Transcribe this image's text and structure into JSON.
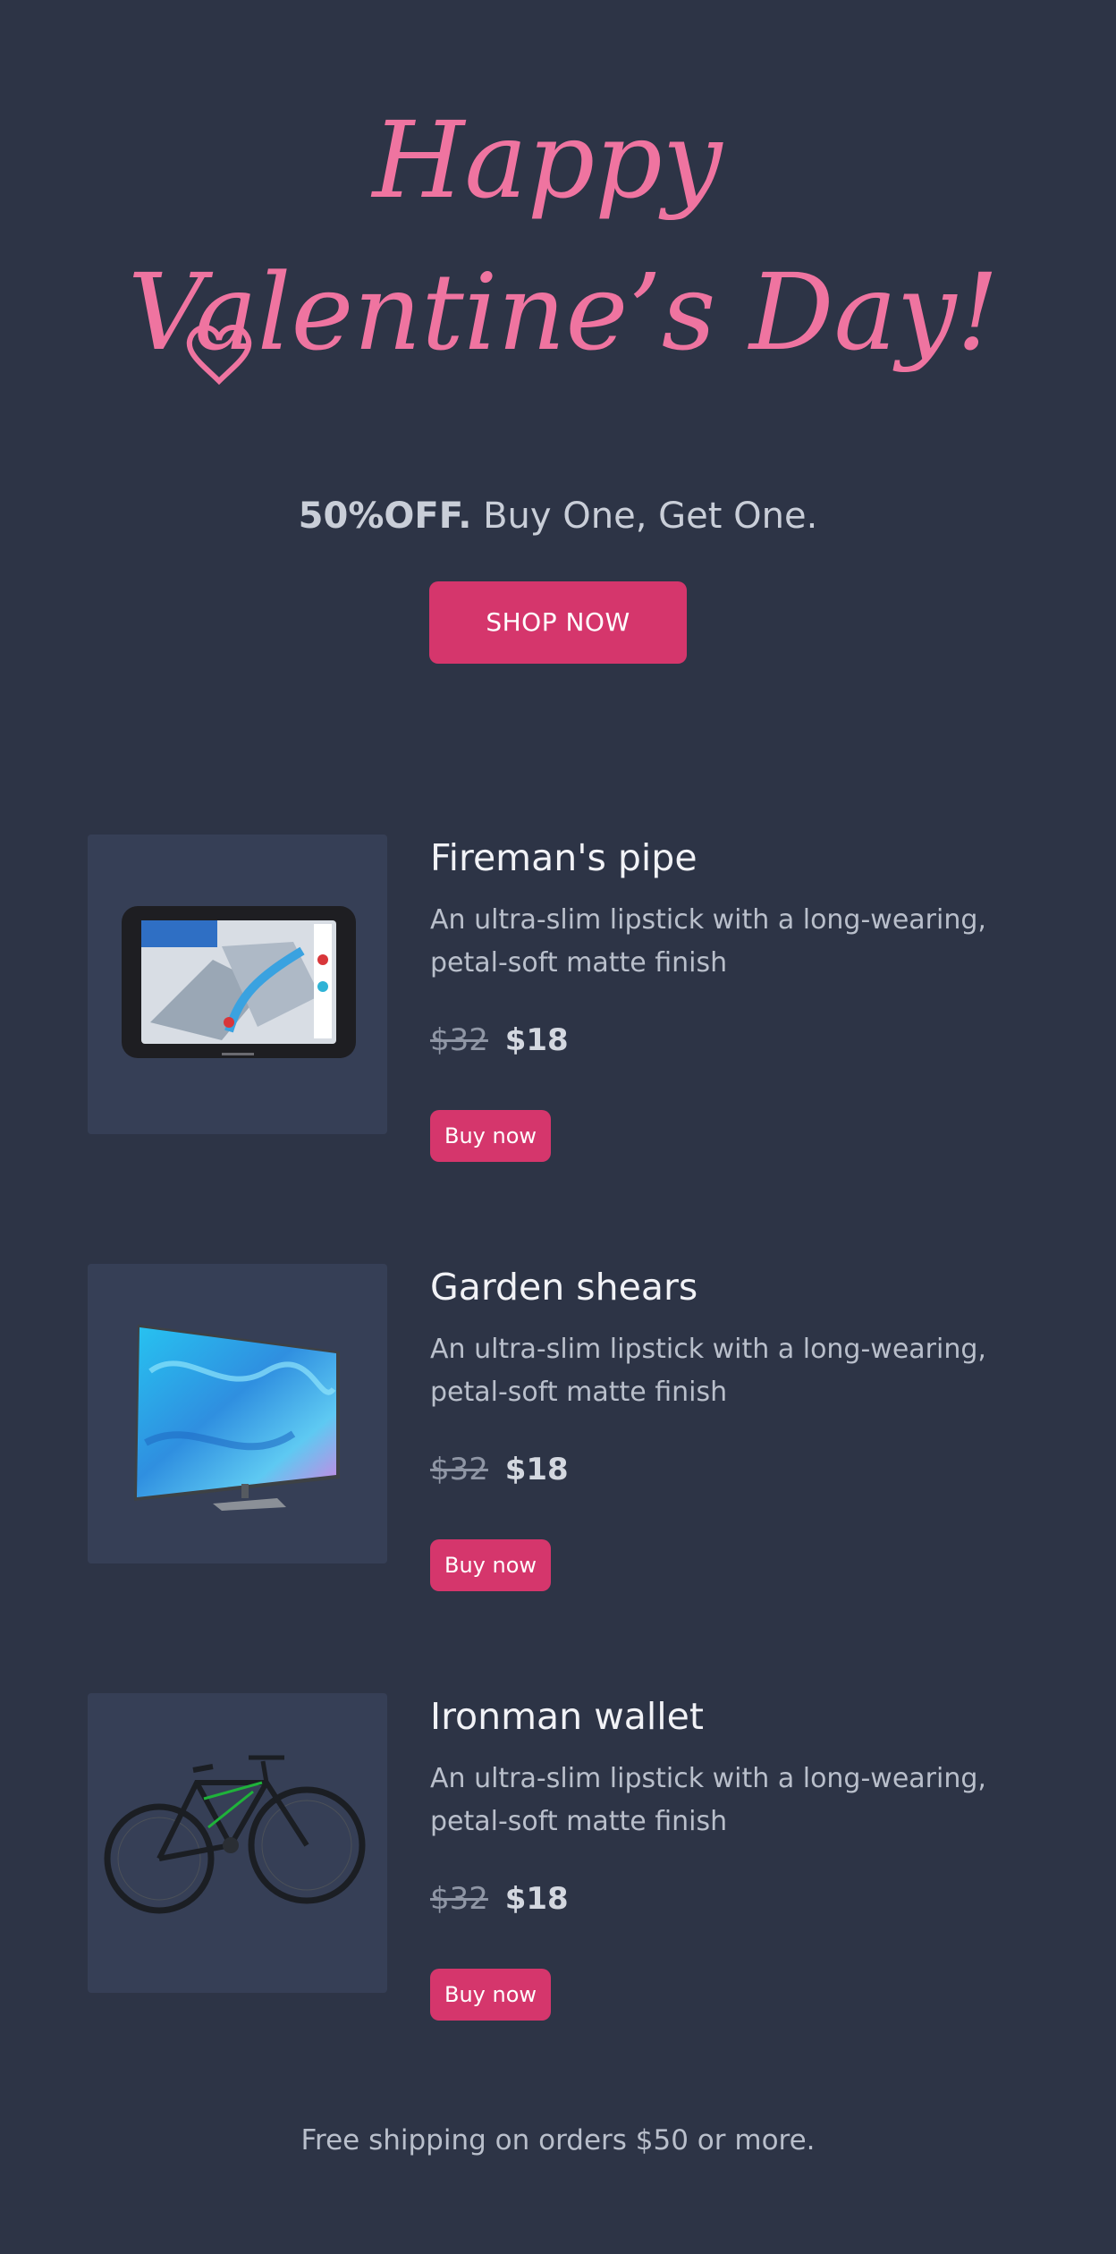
{
  "hero": {
    "title_line_1": "Happy",
    "title_line_2": "Valentine’s Day!",
    "accent_color": "#ef74a0"
  },
  "offer": {
    "strong": "50%OFF.",
    "text": "Buy One, Get One."
  },
  "cta": {
    "shop_now": "SHOP NOW",
    "button_color": "#d5366c"
  },
  "products": [
    {
      "name": "Fireman's pipe",
      "description": "An ultra-slim lipstick with a long-wearing, petal-soft matte finish",
      "old_price": "$32",
      "price": "$18",
      "button": "Buy now",
      "image": "gps-navigator"
    },
    {
      "name": "Garden shears",
      "description": "An ultra-slim lipstick with a long-wearing, petal-soft matte finish",
      "old_price": "$32",
      "price": "$18",
      "button": "Buy now",
      "image": "television"
    },
    {
      "name": "Ironman wallet",
      "description": "An ultra-slim lipstick with a long-wearing, petal-soft matte finish",
      "old_price": "$32",
      "price": "$18",
      "button": "Buy now",
      "image": "mountain-bike"
    }
  ],
  "footer": {
    "text": "Free shipping on orders $50 or more."
  }
}
